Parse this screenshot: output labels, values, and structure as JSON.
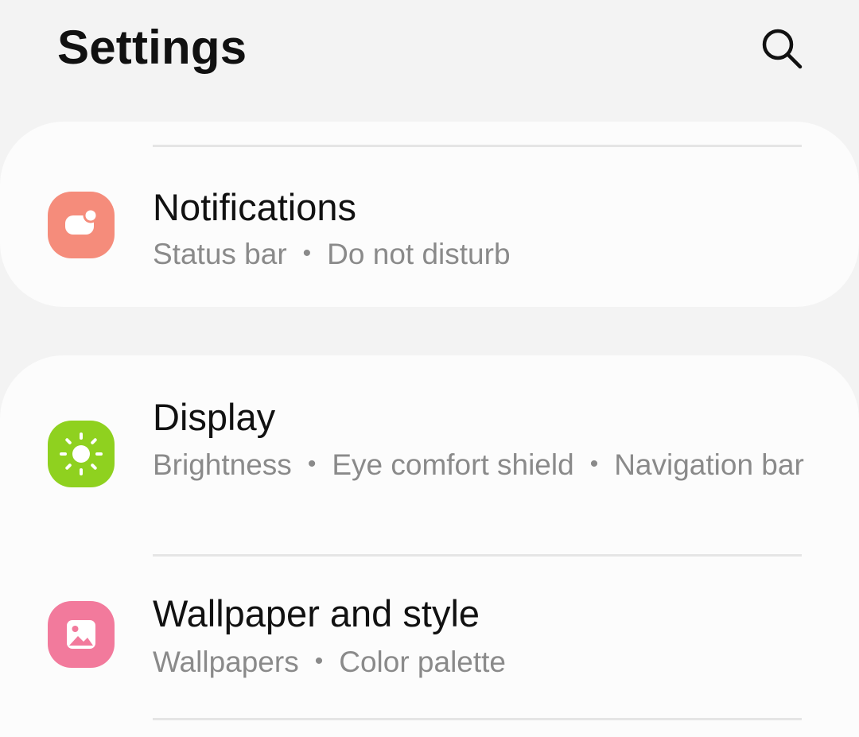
{
  "header": {
    "title": "Settings",
    "search_icon": "search-icon"
  },
  "colors": {
    "background": "#f3f3f3",
    "card": "#fcfcfc",
    "notifications_icon_bg": "#f58c7b",
    "display_icon_bg": "#8fd11f",
    "wallpaper_icon_bg": "#f27a9c",
    "subtitle_text": "#8a8a8a"
  },
  "separator": "•",
  "items": [
    {
      "title": "Notifications",
      "icon": "notifications-icon",
      "subtitle": [
        "Status bar",
        "Do not disturb"
      ]
    },
    {
      "title": "Display",
      "icon": "brightness-icon",
      "subtitle": [
        "Brightness",
        "Eye comfort shield",
        "Navigation bar"
      ]
    },
    {
      "title": "Wallpaper and style",
      "icon": "wallpaper-icon",
      "subtitle": [
        "Wallpapers",
        "Color palette"
      ]
    }
  ]
}
